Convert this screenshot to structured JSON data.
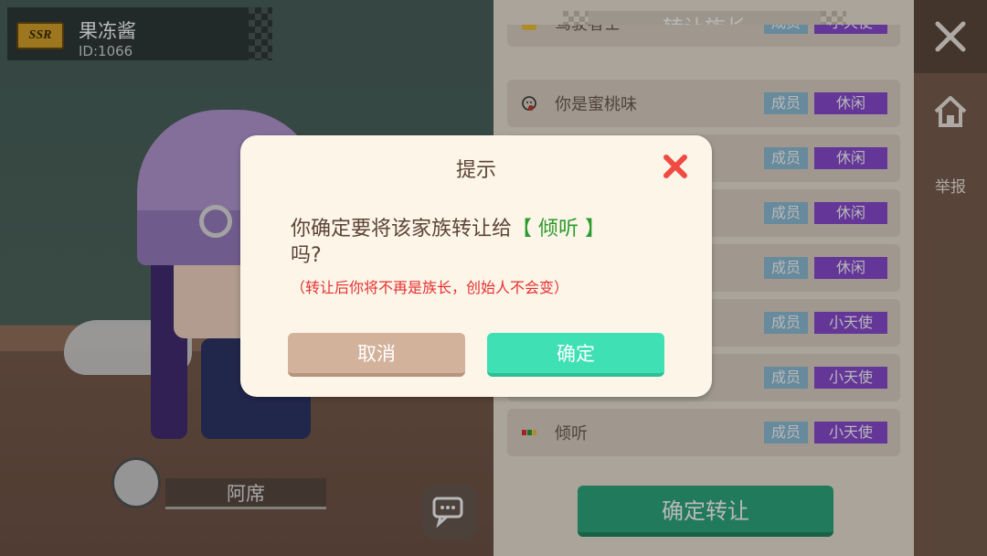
{
  "player": {
    "badge": "SSR",
    "name": "果冻酱",
    "id": "ID:1066"
  },
  "pet": {
    "name": "阿席"
  },
  "panel": {
    "title": "转让族长",
    "members": [
      {
        "name": "驾驶者士",
        "role": "成员",
        "status": "小天使",
        "avatar": "yellow-avatar-icon"
      },
      {
        "name": "你是蜜桃味",
        "role": "成员",
        "status": "休闲",
        "avatar": "face-avatar-icon"
      },
      {
        "name": "",
        "role": "成员",
        "status": "休闲"
      },
      {
        "name": "",
        "role": "成员",
        "status": "休闲"
      },
      {
        "name": "",
        "role": "成员",
        "status": "休闲"
      },
      {
        "name": "",
        "role": "成员",
        "status": "小天使"
      },
      {
        "name": "",
        "role": "成员",
        "status": "小天使"
      },
      {
        "name": "倾听",
        "role": "成员",
        "status": "小天使",
        "avatar": "color-block-avatar-icon"
      }
    ],
    "confirm_label": "确定转让"
  },
  "side": {
    "report_label": "举报"
  },
  "dialog": {
    "title": "提示",
    "message_prefix": "你确定要将该家族转让给",
    "message_target": "【 倾听 】",
    "message_suffix": "吗?",
    "note": "（转让后你将不再是族长，创始人不会变）",
    "cancel_label": "取消",
    "ok_label": "确定"
  },
  "colors": {
    "accent_green": "#2ea97e",
    "ok_button": "#3ee0b4",
    "cancel_button": "#d3b29c",
    "status_purple": "#8a4bd3",
    "role_blue": "#8fc0da",
    "warning_red": "#e53030",
    "highlight_green": "#2b9b2e"
  }
}
